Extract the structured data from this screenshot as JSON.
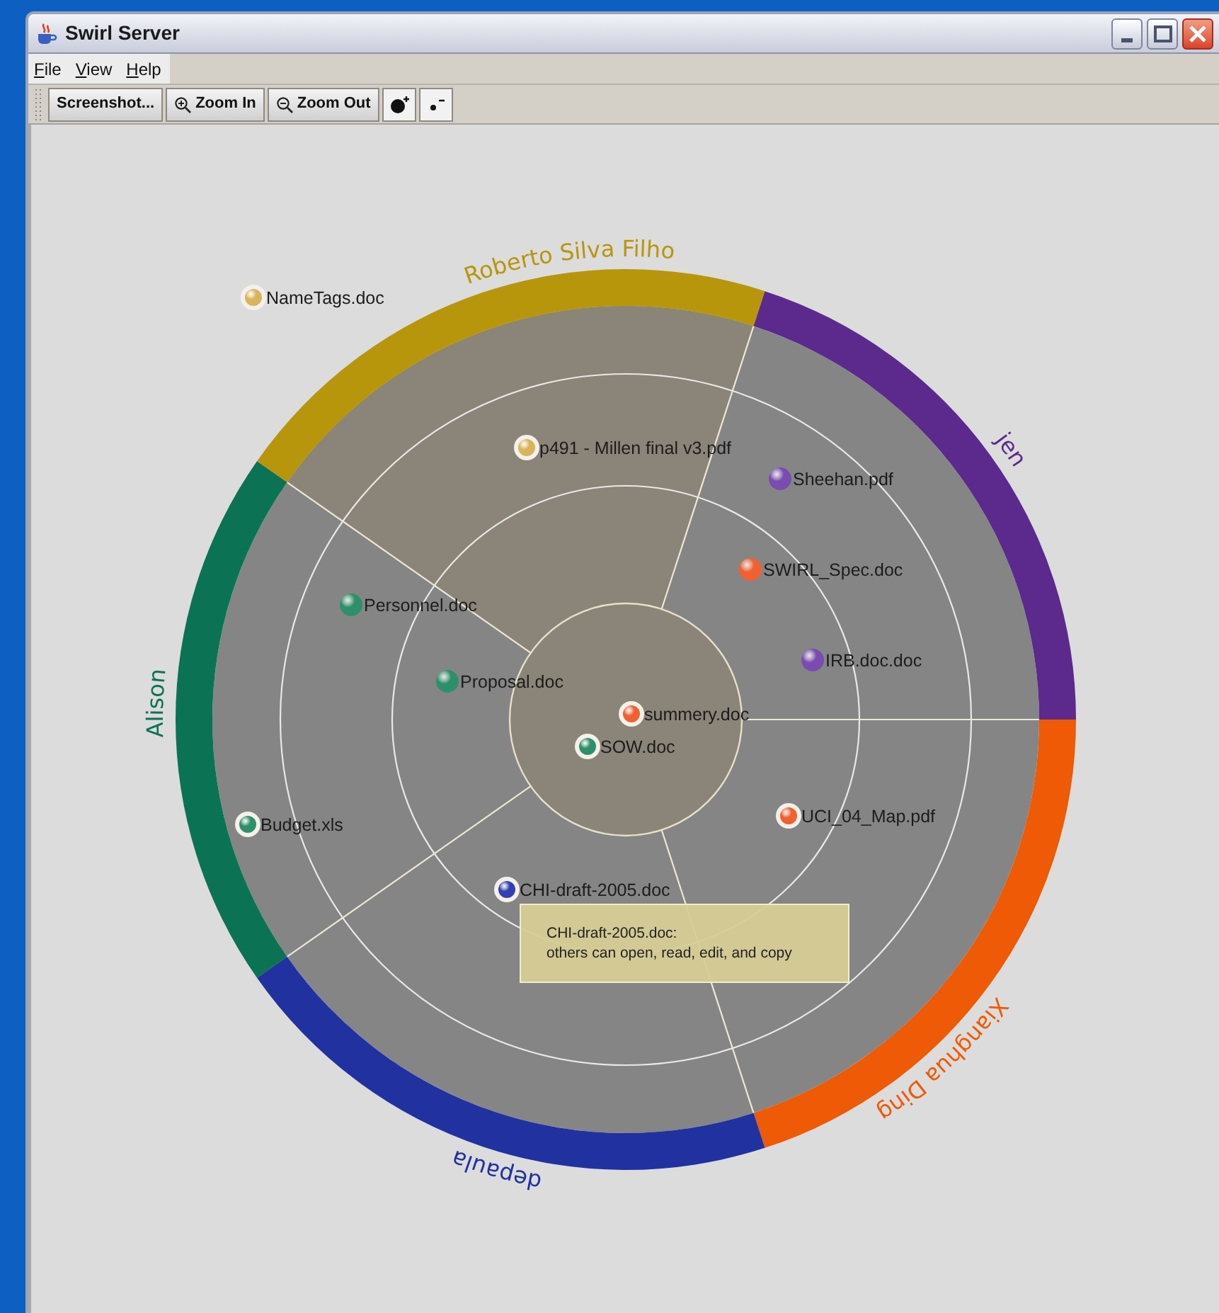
{
  "window": {
    "title": "Swirl Server"
  },
  "menu": [
    {
      "label": "File"
    },
    {
      "label": "View"
    },
    {
      "label": "Help"
    }
  ],
  "toolbar": [
    {
      "kind": "text",
      "label": "Screenshot..."
    },
    {
      "kind": "zoom-in",
      "label": "Zoom In"
    },
    {
      "kind": "zoom-out",
      "label": "Zoom Out"
    },
    {
      "kind": "grow"
    },
    {
      "kind": "shrink"
    }
  ],
  "owners": [
    {
      "name": "Roberto Silva Filho",
      "color": "#b8960c",
      "selected": true
    },
    {
      "name": "jen",
      "color": "#5b2a8c",
      "selected": false
    },
    {
      "name": "Alison",
      "color": "#0b7353",
      "selected": false
    },
    {
      "name": "Xianghua Ding",
      "color": "#ee5a05",
      "selected": false
    },
    {
      "name": "depaula",
      "color": "#2231a0",
      "selected": false
    }
  ],
  "files": [
    {
      "name": "NameTags.doc",
      "color": "#d9b45c",
      "halo": true
    },
    {
      "name": "p491 - Millen final v3.pdf",
      "color": "#d9b45c",
      "halo": true
    },
    {
      "name": "Sheehan.pdf",
      "color": "#7a4cb0",
      "halo": false
    },
    {
      "name": "SWIRL_Spec.doc",
      "color": "#f06030",
      "halo": false
    },
    {
      "name": "IRB.doc.doc",
      "color": "#7a4cb0",
      "halo": false
    },
    {
      "name": "Personnel.doc",
      "color": "#2f8f6a",
      "halo": false
    },
    {
      "name": "Proposal.doc",
      "color": "#2f8f6a",
      "halo": false
    },
    {
      "name": "summery.doc",
      "color": "#f06030",
      "halo": true
    },
    {
      "name": "SOW.doc",
      "color": "#2f8f6a",
      "halo": true
    },
    {
      "name": "Budget.xls",
      "color": "#2f8f6a",
      "halo": true
    },
    {
      "name": "UCI_04_Map.pdf",
      "color": "#f06030",
      "halo": true
    },
    {
      "name": "CHI-draft-2005.doc",
      "color": "#3440b0",
      "halo": true
    }
  ],
  "tooltip": {
    "lines": [
      "CHI-draft-2005.doc:",
      "others can open, read, edit, and copy"
    ]
  }
}
